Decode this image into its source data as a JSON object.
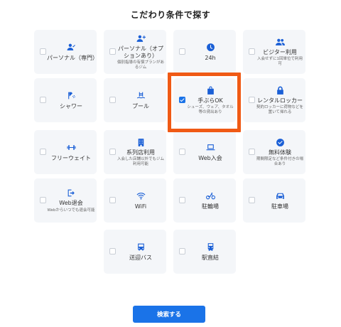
{
  "title": "こだわり条件で探す",
  "items": [
    {
      "label": "パーソナル（専門）",
      "sub": "",
      "icon": "person-check-icon",
      "checked": false
    },
    {
      "label": "パーソナル（オプションあり）",
      "sub": "個別指導の有償プランがあるジム",
      "icon": "person-add-icon",
      "checked": false
    },
    {
      "label": "24h",
      "sub": "",
      "icon": "clock-icon",
      "checked": false
    },
    {
      "label": "ビジター利用",
      "sub": "入会せずに1回単位で利用可",
      "icon": "people-icon",
      "checked": false
    },
    {
      "label": "シャワー",
      "sub": "",
      "icon": "shower-icon",
      "checked": false
    },
    {
      "label": "プール",
      "sub": "",
      "icon": "pool-icon",
      "checked": false
    },
    {
      "label": "手ぶらOK",
      "sub": "シューズ、ウェア、タオル等の貸出あり",
      "icon": "bag-icon",
      "checked": true
    },
    {
      "label": "レンタルロッカー",
      "sub": "契約ロッカーに荷物などを置いて帰れる",
      "icon": "lock-icon",
      "checked": false
    },
    {
      "label": "フリーウェイト",
      "sub": "",
      "icon": "dumbbell-icon",
      "checked": false
    },
    {
      "label": "系列店利用",
      "sub": "入会した店舗以外でもジム利用可能",
      "icon": "building-icon",
      "checked": false
    },
    {
      "label": "Web入会",
      "sub": "",
      "icon": "laptop-icon",
      "checked": false
    },
    {
      "label": "無料体験",
      "sub": "期間限定など条件付きの場合あり",
      "icon": "check-circle-icon",
      "checked": false
    },
    {
      "label": "Web退会",
      "sub": "Webからいつでも退会可能",
      "icon": "exit-icon",
      "checked": false
    },
    {
      "label": "WiFi",
      "sub": "",
      "icon": "wifi-icon",
      "checked": false
    },
    {
      "label": "駐輪場",
      "sub": "",
      "icon": "bicycle-icon",
      "checked": false
    },
    {
      "label": "駐車場",
      "sub": "",
      "icon": "car-icon",
      "checked": false
    },
    {
      "label": "送迎バス",
      "sub": "",
      "icon": "bus-icon",
      "checked": false
    },
    {
      "label": "駅直結",
      "sub": "",
      "icon": "train-icon",
      "checked": false
    }
  ],
  "search_label": "検索する",
  "colors": {
    "accent": "#1a73e8",
    "highlight": "#f05a15",
    "card_bg": "#f4f6f9"
  }
}
